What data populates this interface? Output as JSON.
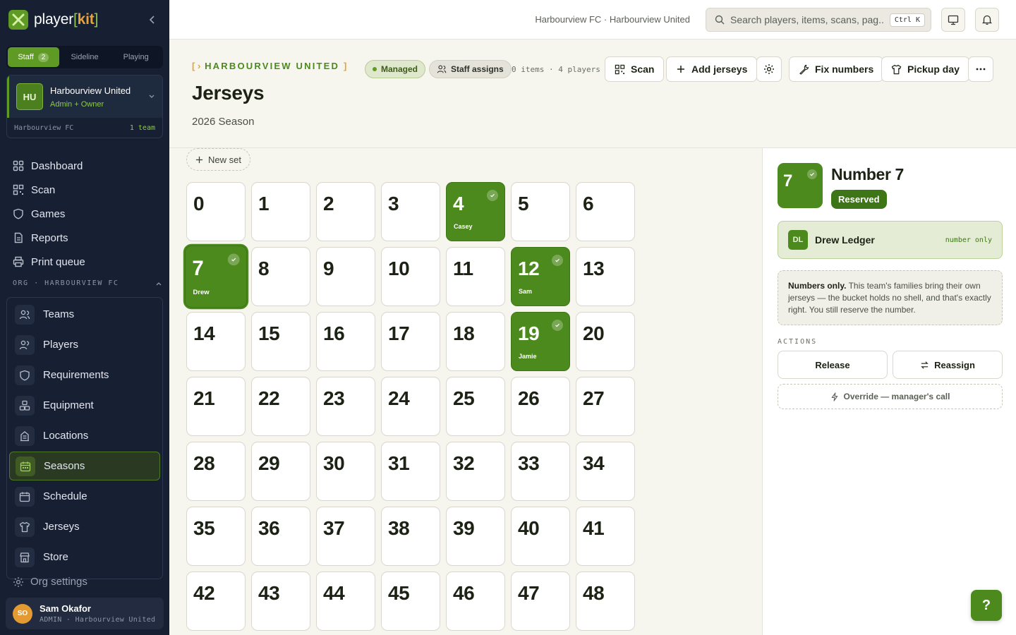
{
  "brand": {
    "name_player": "player",
    "name_kit": "kit"
  },
  "mode_tabs": [
    {
      "label": "Staff",
      "count": "2"
    },
    {
      "label": "Sideline"
    },
    {
      "label": "Playing"
    }
  ],
  "team_card": {
    "initials": "HU",
    "name": "Harbourview United",
    "role": "Admin + Owner",
    "org": "Harbourview FC",
    "team_count": "1 team"
  },
  "nav": [
    {
      "label": "Dashboard",
      "icon": "dashboard-icon"
    },
    {
      "label": "Scan",
      "icon": "qr-scan-icon"
    },
    {
      "label": "Games",
      "icon": "shield-icon"
    },
    {
      "label": "Reports",
      "icon": "document-icon"
    },
    {
      "label": "Print queue",
      "icon": "printer-icon"
    }
  ],
  "org_section": {
    "label": "ORG · HARBOURVIEW FC"
  },
  "org_nav": [
    {
      "label": "Teams",
      "icon": "users-icon"
    },
    {
      "label": "Players",
      "icon": "user-group-icon"
    },
    {
      "label": "Requirements",
      "icon": "shield-check-icon"
    },
    {
      "label": "Equipment",
      "icon": "equipment-icon"
    },
    {
      "label": "Locations",
      "icon": "building-icon"
    },
    {
      "label": "Seasons",
      "icon": "calendar-icon",
      "active": true
    },
    {
      "label": "Schedule",
      "icon": "schedule-icon"
    },
    {
      "label": "Jerseys",
      "icon": "shirt-icon"
    },
    {
      "label": "Store",
      "icon": "store-icon"
    }
  ],
  "org_settings": "Org settings",
  "user": {
    "initials": "SO",
    "name": "Sam Okafor",
    "sub": "ADMIN · Harbourview United"
  },
  "topbar": {
    "breadcrumb": "Harbourview FC · Harbourview United",
    "search_placeholder": "Search players, items, scans, pag...",
    "search_kbd": "Ctrl K"
  },
  "header": {
    "eyebrow": "HARBOURVIEW UNITED",
    "eyebrow_open": "[ ›",
    "eyebrow_close": "]",
    "title": "Jerseys",
    "subtitle": "2026 Season",
    "pill_managed": "Managed",
    "pill_staff": "Staff assigns",
    "counts": "0 items · 4 players",
    "btn_scan": "Scan",
    "btn_add": "Add jerseys",
    "btn_fix": "Fix numbers",
    "btn_pickup": "Pickup day"
  },
  "new_set_label": "New set",
  "jerseys": {
    "total": 49,
    "taken": [
      {
        "number": "4",
        "player": "Casey"
      },
      {
        "number": "7",
        "player": "Drew",
        "selected": true
      },
      {
        "number": "12",
        "player": "Sam"
      },
      {
        "number": "19",
        "player": "Jamie"
      }
    ]
  },
  "panel": {
    "number": "7",
    "title": "Number 7",
    "status": "Reserved",
    "holder_initials": "DL",
    "holder_name": "Drew Ledger",
    "holder_tag": "number only",
    "note_bold": "Numbers only.",
    "note_text": " This team's families bring their own jerseys — the bucket holds no shell, and that's exactly right. You still reserve the number.",
    "actions_label": "ACTIONS",
    "release": "Release",
    "reassign": "Reassign",
    "override": "Override — manager's call"
  },
  "help_label": "?",
  "colors": {
    "accent": "#4c8a1e",
    "sidebar": "#171f33",
    "brand_orange": "#e6a33a"
  }
}
